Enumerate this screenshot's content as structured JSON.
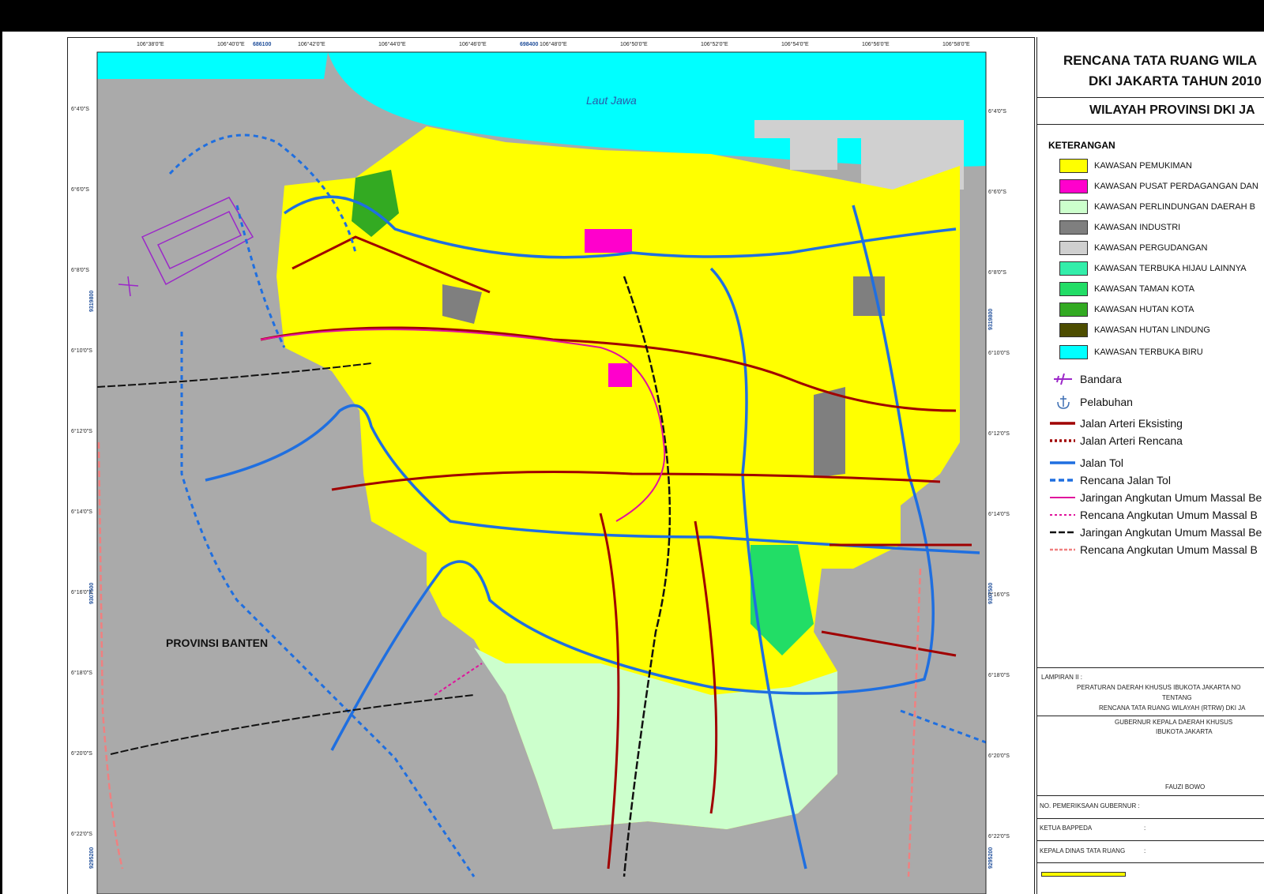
{
  "map": {
    "sea_label": "Laut Jawa",
    "region_label": "PROVINSI BANTEN",
    "lon_ticks": [
      "106°38'0\"E",
      "106°40'0\"E",
      "106°42'0\"E",
      "106°44'0\"E",
      "106°46'0\"E",
      "106°48'0\"E",
      "106°50'0\"E",
      "106°52'0\"E",
      "106°54'0\"E",
      "106°56'0\"E",
      "106°58'0\"E"
    ],
    "lat_ticks": [
      "6°4'0\"S",
      "6°6'0\"S",
      "6°8'0\"S",
      "6°10'0\"S",
      "6°12'0\"S",
      "6°14'0\"S",
      "6°16'0\"S",
      "6°18'0\"S",
      "6°20'0\"S",
      "6°22'0\"S"
    ],
    "grid_x": [
      "686100",
      "698400"
    ],
    "grid_y": [
      "9319800",
      "9307500",
      "9295200"
    ],
    "colors": {
      "sea": "#00ffff",
      "outside": "#aaaaaa",
      "pemukiman": "#ffff00",
      "protected": "#ccffcc",
      "arteri": "#a00000",
      "tol": "#1f6fe0",
      "massal": "#e0139c",
      "airport": "#9c27c9"
    }
  },
  "panel": {
    "title_line1": "RENCANA TATA RUANG WILA",
    "title_line2": "DKI JAKARTA TAHUN 2010",
    "subtitle": "WILAYAH PROVINSI DKI JA",
    "keterangan": "KETERANGAN",
    "legend": [
      {
        "label": "KAWASAN PEMUKIMAN",
        "color": "#ffff00"
      },
      {
        "label": "KAWASAN PUSAT PERDAGANGAN DAN",
        "color": "#ff00cc"
      },
      {
        "label": "KAWASAN PERLINDUNGAN DAERAH B",
        "color": "#ccffcc"
      },
      {
        "label": "KAWASAN INDUSTRI",
        "color": "#7f7f7f"
      },
      {
        "label": "KAWASAN PERGUDANGAN",
        "color": "#cfcfcf"
      },
      {
        "label": "KAWASAN TERBUKA HIJAU LAINNYA",
        "color": "#33eeaa"
      },
      {
        "label": "KAWASAN TAMAN KOTA",
        "color": "#22dd66"
      },
      {
        "label": "KAWASAN HUTAN KOTA",
        "color": "#33aa22"
      },
      {
        "label": "KAWASAN HUTAN LINDUNG",
        "color": "#4d4d00"
      },
      {
        "label": "KAWASAN TERBUKA BIRU",
        "color": "#00ffff"
      }
    ],
    "symbols": [
      {
        "label": "Bandara",
        "icon": "airplane-icon"
      },
      {
        "label": "Pelabuhan",
        "icon": "anchor-icon"
      }
    ],
    "lines": [
      {
        "label": "Jalan Arteri Eksisting",
        "color": "#a00000",
        "style": "solid"
      },
      {
        "label": "Jalan Arteri Rencana",
        "color": "#a00000",
        "style": "dotted"
      },
      {
        "label": "Jalan Tol",
        "color": "#1f6fe0",
        "style": "solid"
      },
      {
        "label": "Rencana Jalan Tol",
        "color": "#1f6fe0",
        "style": "dashed"
      },
      {
        "label": "Jaringan Angkutan Umum Massal Be",
        "color": "#e0139c",
        "style": "solid"
      },
      {
        "label": "Rencana Angkutan Umum Massal B",
        "color": "#e0139c",
        "style": "dashed"
      },
      {
        "label": "Jaringan Angkutan Umum Massal Be",
        "color": "#111111",
        "style": "rail"
      },
      {
        "label": "Rencana Angkutan Umum Massal B",
        "color": "#f08080",
        "style": "rail-dashed"
      }
    ],
    "lampiran": "LAMPIRAN II :",
    "perda1": "PERATURAN DAERAH KHUSUS IBUKOTA JAKARTA NO",
    "perda2": "TENTANG",
    "perda3": "RENCANA TATA RUANG WILAYAH (RTRW) DKI JA",
    "gubernur1": "GUBERNUR KEPALA DAERAH KHUSUS",
    "gubernur2": "IBUKOTA JAKARTA",
    "signer": "FAUZI BOWO",
    "pemeriksaan": "NO. PEMERIKSAAN GUBERNUR :",
    "ketua": "KETUA BAPPEDA",
    "kepala": "KEPALA DINAS TATA RUANG",
    "colon": ":"
  }
}
